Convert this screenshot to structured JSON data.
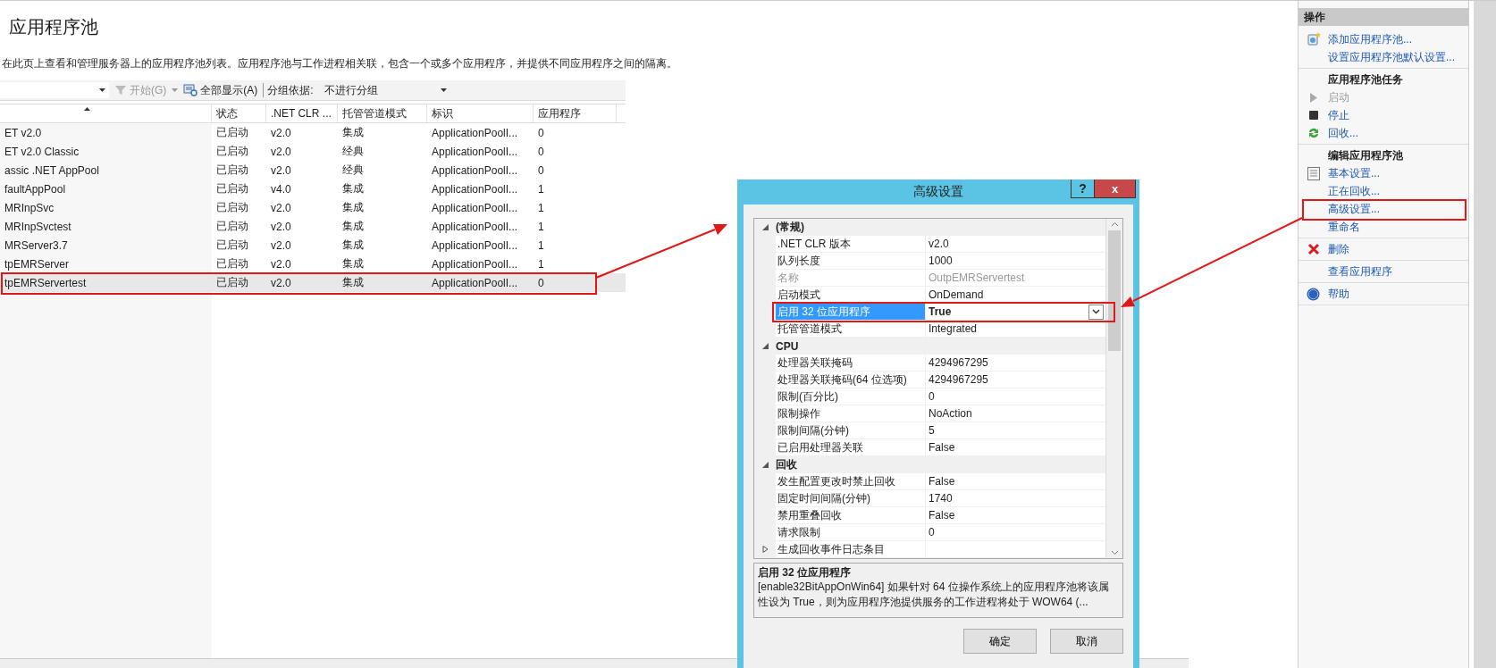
{
  "page": {
    "title": "应用程序池",
    "description": "在此页上查看和管理服务器上的应用程序池列表。应用程序池与工作进程相关联，包含一个或多个应用程序，并提供不同应用程序之间的隔离。"
  },
  "toolbar": {
    "start_button": {
      "label": "开始(G)",
      "disabled": true
    },
    "show_all_button": {
      "label": "全部显示(A)",
      "disabled": false
    },
    "group_by": {
      "label": "分组依据:",
      "value": "不进行分组"
    }
  },
  "table": {
    "columns": [
      {
        "sorted": true
      },
      {
        "label": "状态",
        "sorted": false
      },
      {
        "label": ".NET CLR ...",
        "sorted": false
      },
      {
        "label": "托管管道模式",
        "sorted": false
      },
      {
        "label": "标识",
        "sorted": false
      },
      {
        "label": "应用程序",
        "sorted": false
      }
    ],
    "rows": [
      {
        "name": "ET v2.0",
        "status": "已启动",
        "clr": "v2.0",
        "pipeline": "集成",
        "identity": "ApplicationPoolI...",
        "applications": "0",
        "selected": false
      },
      {
        "name": "ET v2.0 Classic",
        "status": "已启动",
        "clr": "v2.0",
        "pipeline": "经典",
        "identity": "ApplicationPoolI...",
        "applications": "0",
        "selected": false
      },
      {
        "name": "assic .NET AppPool",
        "status": "已启动",
        "clr": "v2.0",
        "pipeline": "经典",
        "identity": "ApplicationPoolI...",
        "applications": "0",
        "selected": false
      },
      {
        "name": "faultAppPool",
        "status": "已启动",
        "clr": "v4.0",
        "pipeline": "集成",
        "identity": "ApplicationPoolI...",
        "applications": "1",
        "selected": false
      },
      {
        "name": "MRInpSvc",
        "status": "已启动",
        "clr": "v2.0",
        "pipeline": "集成",
        "identity": "ApplicationPoolI...",
        "applications": "1",
        "selected": false
      },
      {
        "name": "MRInpSvctest",
        "status": "已启动",
        "clr": "v2.0",
        "pipeline": "集成",
        "identity": "ApplicationPoolI...",
        "applications": "1",
        "selected": false
      },
      {
        "name": "MRServer3.7",
        "status": "已启动",
        "clr": "v2.0",
        "pipeline": "集成",
        "identity": "ApplicationPoolI...",
        "applications": "1",
        "selected": false
      },
      {
        "name": "tpEMRServer",
        "status": "已启动",
        "clr": "v2.0",
        "pipeline": "集成",
        "identity": "ApplicationPoolI...",
        "applications": "1",
        "selected": false
      },
      {
        "name": "tpEMRServertest",
        "status": "已启动",
        "clr": "v2.0",
        "pipeline": "集成",
        "identity": "ApplicationPoolI...",
        "applications": "0",
        "selected": true
      }
    ]
  },
  "actions": {
    "title": "操作",
    "groups": [
      {
        "items": [
          {
            "kind": "add",
            "label": "添加应用程序池...",
            "disabled": false
          },
          {
            "kind": "plain",
            "label": "设置应用程序池默认设置...",
            "disabled": false
          }
        ]
      },
      {
        "heading": "应用程序池任务",
        "items": [
          {
            "kind": "start",
            "label": "启动",
            "disabled": true
          },
          {
            "kind": "stop",
            "label": "停止",
            "disabled": false
          },
          {
            "kind": "recycle",
            "label": "回收...",
            "disabled": false
          }
        ]
      },
      {
        "heading": "编辑应用程序池",
        "items": [
          {
            "kind": "settings",
            "label": "基本设置...",
            "disabled": false
          },
          {
            "kind": "plain",
            "label": "正在回收...",
            "disabled": false
          },
          {
            "kind": "plain",
            "label": "高级设置...",
            "disabled": false
          },
          {
            "kind": "plain",
            "label": "重命名",
            "disabled": false
          }
        ]
      },
      {
        "items": [
          {
            "kind": "delete",
            "label": "删除",
            "disabled": false
          }
        ]
      },
      {
        "items": [
          {
            "kind": "plain",
            "label": "查看应用程序",
            "disabled": false
          }
        ]
      },
      {
        "items": [
          {
            "kind": "help",
            "label": "帮助",
            "disabled": false
          }
        ]
      }
    ]
  },
  "dialog": {
    "title": "高级设置",
    "help_button": "?",
    "close_button": "x",
    "categories": [
      {
        "name": "(常规)",
        "expanded": true,
        "properties": [
          {
            "kind": "value",
            "name": ".NET CLR 版本",
            "value": "v2.0",
            "disabled": false,
            "selected": false
          },
          {
            "kind": "value",
            "name": "队列长度",
            "value": "1000",
            "disabled": false,
            "selected": false
          },
          {
            "kind": "value",
            "name": "名称",
            "value": "OutpEMRServertest",
            "disabled": true,
            "selected": false
          },
          {
            "kind": "value",
            "name": "启动模式",
            "value": "OnDemand",
            "disabled": false,
            "selected": false
          },
          {
            "kind": "value",
            "name": "启用 32 位应用程序",
            "value": "True",
            "disabled": false,
            "selected": true
          },
          {
            "kind": "value",
            "name": "托管管道模式",
            "value": "Integrated",
            "disabled": false,
            "selected": false
          }
        ]
      },
      {
        "name": "CPU",
        "expanded": true,
        "properties": [
          {
            "kind": "value",
            "name": "处理器关联掩码",
            "value": "4294967295",
            "disabled": false,
            "selected": false
          },
          {
            "kind": "value",
            "name": "处理器关联掩码(64 位选项)",
            "value": "4294967295",
            "disabled": false,
            "selected": false
          },
          {
            "kind": "value",
            "name": "限制(百分比)",
            "value": "0",
            "disabled": false,
            "selected": false
          },
          {
            "kind": "value",
            "name": "限制操作",
            "value": "NoAction",
            "disabled": false,
            "selected": false
          },
          {
            "kind": "value",
            "name": "限制间隔(分钟)",
            "value": "5",
            "disabled": false,
            "selected": false
          },
          {
            "kind": "value",
            "name": "已启用处理器关联",
            "value": "False",
            "disabled": false,
            "selected": false
          }
        ]
      },
      {
        "name": "回收",
        "expanded": true,
        "properties": [
          {
            "kind": "value",
            "name": "发生配置更改时禁止回收",
            "value": "False",
            "disabled": false,
            "selected": false
          },
          {
            "kind": "value",
            "name": "固定时间间隔(分钟)",
            "value": "1740",
            "disabled": false,
            "selected": false
          },
          {
            "kind": "value",
            "name": "禁用重叠回收",
            "value": "False",
            "disabled": false,
            "selected": false
          },
          {
            "kind": "value",
            "name": "请求限制",
            "value": "0",
            "disabled": false,
            "selected": false
          },
          {
            "kind": "group",
            "name": "生成回收事件日志条目",
            "expanded": false,
            "disabled": false,
            "selected": false
          }
        ]
      }
    ],
    "description": {
      "title": "启用 32 位应用程序",
      "text": "[enable32BitAppOnWin64] 如果针对 64 位操作系统上的应用程序池将该属性设为 True，则为应用程序池提供服务的工作进程将处于 WOW64 (..."
    },
    "buttons": [
      "确定",
      "取消"
    ]
  }
}
